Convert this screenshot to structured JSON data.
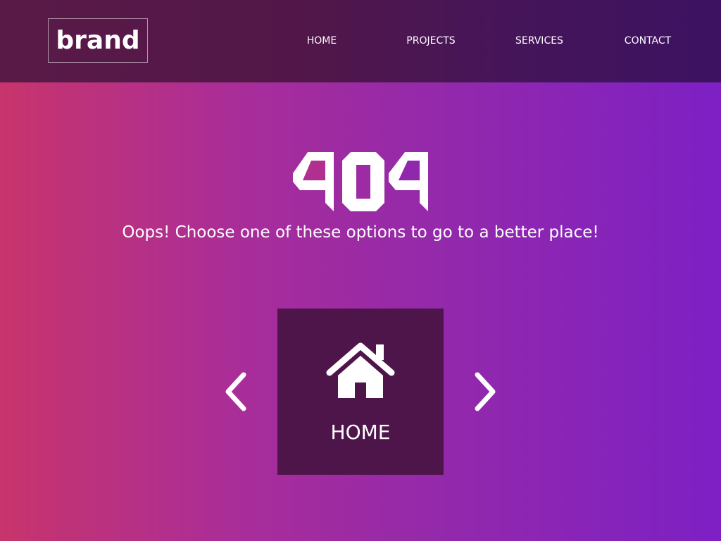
{
  "header": {
    "logo_text": "brand",
    "nav": [
      {
        "label": "HOME"
      },
      {
        "label": "PROJECTS"
      },
      {
        "label": "SERVICES"
      },
      {
        "label": "CONTACT"
      }
    ]
  },
  "main": {
    "error_code": "404",
    "message": "Oops! Choose one of these options to go to a better place!",
    "carousel": {
      "current_label": "HOME",
      "current_icon": "home-icon",
      "prev_icon": "chevron-left-icon",
      "next_icon": "chevron-right-icon"
    }
  },
  "colors": {
    "gradient_left": "#c8346c",
    "gradient_right": "#7d20c4",
    "navbar": "#4a1650",
    "card": "#4e154a",
    "text": "#ffffff"
  }
}
